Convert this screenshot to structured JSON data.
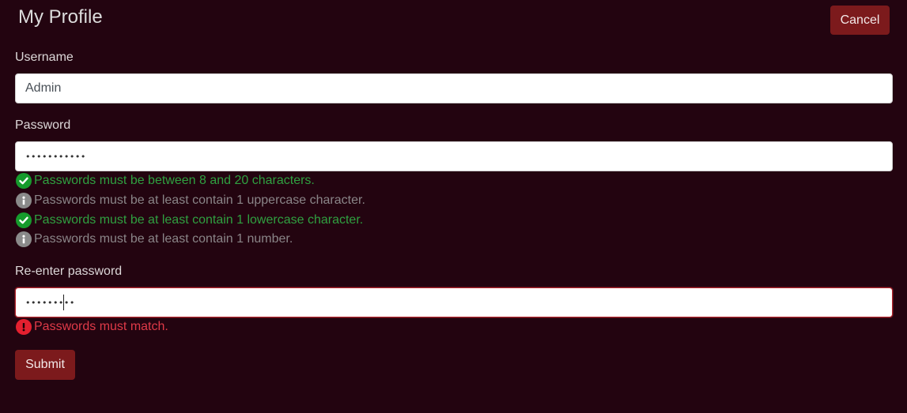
{
  "page": {
    "title": "My Profile",
    "cancel_label": "Cancel",
    "submit_label": "Submit"
  },
  "form": {
    "username": {
      "label": "Username",
      "value": "Admin"
    },
    "password": {
      "label": "Password",
      "value": "•••••••••••"
    },
    "reenter_password": {
      "label": "Re-enter password",
      "value": "•••••••••"
    }
  },
  "password_rules": [
    {
      "text": "Passwords must be between 8 and 20 characters.",
      "status": "ok",
      "icon": "check-circle-icon"
    },
    {
      "text": "Passwords must be at least contain 1 uppercase character.",
      "status": "info",
      "icon": "info-circle-icon"
    },
    {
      "text": "Passwords must be at least contain 1 lowercase character.",
      "status": "ok",
      "icon": "check-circle-icon"
    },
    {
      "text": "Passwords must be at least contain 1 number.",
      "status": "info",
      "icon": "info-circle-icon"
    }
  ],
  "match_error": {
    "text": "Passwords must match.",
    "status": "error",
    "icon": "exclamation-circle-icon"
  },
  "colors": {
    "background": "#230410",
    "button": "#7c1a1c",
    "valid": "#169b2c",
    "neutral": "#8a8a8a",
    "error": "#e4202f"
  }
}
